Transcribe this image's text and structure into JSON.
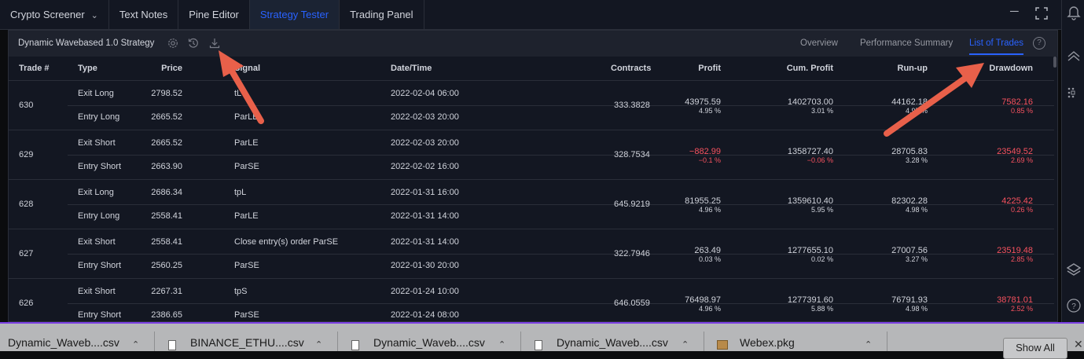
{
  "top_tabs": [
    {
      "label": "Crypto Screener",
      "has_dropdown": true,
      "active": false
    },
    {
      "label": "Text Notes",
      "active": false
    },
    {
      "label": "Pine Editor",
      "active": false
    },
    {
      "label": "Strategy Tester",
      "active": true
    },
    {
      "label": "Trading Panel",
      "active": false
    }
  ],
  "strategy": {
    "title": "Dynamic Wavebased 1.0 Strategy",
    "tabs": [
      {
        "label": "Overview",
        "active": false
      },
      {
        "label": "Performance Summary",
        "active": false
      },
      {
        "label": "List of Trades",
        "active": true
      }
    ]
  },
  "table": {
    "headers": {
      "trade": "Trade #",
      "type": "Type",
      "signal": "Signal",
      "datetime": "Date/Time",
      "price": "Price",
      "contracts": "Contracts",
      "profit": "Profit",
      "cum_profit": "Cum. Profit",
      "runup": "Run-up",
      "drawdown": "Drawdown"
    },
    "trades": [
      {
        "num": "630",
        "exit": {
          "type": "Exit Long",
          "signal": "tL",
          "datetime": "2022-02-04 06:00",
          "price": "2798.52"
        },
        "entry": {
          "type": "Entry Long",
          "signal": "ParLE",
          "datetime": "2022-02-03 20:00",
          "price": "2665.52"
        },
        "contracts": "333.3828",
        "profit": "43975.59",
        "profit_pct": "4.95 %",
        "cum_profit": "1402703.00",
        "cum_profit_pct": "3.01 %",
        "runup": "44162.18",
        "runup_pct": "4.97 %",
        "drawdown": "7582.16",
        "drawdown_pct": "0.85 %"
      },
      {
        "num": "629",
        "exit": {
          "type": "Exit Short",
          "signal": "ParLE",
          "datetime": "2022-02-03 20:00",
          "price": "2665.52"
        },
        "entry": {
          "type": "Entry Short",
          "signal": "ParSE",
          "datetime": "2022-02-02 16:00",
          "price": "2663.90"
        },
        "contracts": "328.7534",
        "profit": "−882.99",
        "profit_pct": "−0.1 %",
        "cum_profit": "1358727.40",
        "cum_profit_pct": "−0.06 %",
        "runup": "28705.83",
        "runup_pct": "3.28 %",
        "drawdown": "23549.52",
        "drawdown_pct": "2.69 %"
      },
      {
        "num": "628",
        "exit": {
          "type": "Exit Long",
          "signal": "tpL",
          "datetime": "2022-01-31 16:00",
          "price": "2686.34"
        },
        "entry": {
          "type": "Entry Long",
          "signal": "ParLE",
          "datetime": "2022-01-31 14:00",
          "price": "2558.41"
        },
        "contracts": "645.9219",
        "profit": "81955.25",
        "profit_pct": "4.96 %",
        "cum_profit": "1359610.40",
        "cum_profit_pct": "5.95 %",
        "runup": "82302.28",
        "runup_pct": "4.98 %",
        "drawdown": "4225.42",
        "drawdown_pct": "0.26 %"
      },
      {
        "num": "627",
        "exit": {
          "type": "Exit Short",
          "signal": "Close entry(s) order ParSE",
          "datetime": "2022-01-31 14:00",
          "price": "2558.41"
        },
        "entry": {
          "type": "Entry Short",
          "signal": "ParSE",
          "datetime": "2022-01-30 20:00",
          "price": "2560.25"
        },
        "contracts": "322.7946",
        "profit": "263.49",
        "profit_pct": "0.03 %",
        "cum_profit": "1277655.10",
        "cum_profit_pct": "0.02 %",
        "runup": "27007.56",
        "runup_pct": "3.27 %",
        "drawdown": "23519.48",
        "drawdown_pct": "2.85 %"
      },
      {
        "num": "626",
        "exit": {
          "type": "Exit Short",
          "signal": "tpS",
          "datetime": "2022-01-24 10:00",
          "price": "2267.31"
        },
        "entry": {
          "type": "Entry Short",
          "signal": "ParSE",
          "datetime": "2022-01-24 08:00",
          "price": "2386.65"
        },
        "contracts": "646.0559",
        "profit": "76498.97",
        "profit_pct": "4.96 %",
        "cum_profit": "1277391.60",
        "cum_profit_pct": "5.88 %",
        "runup": "76791.93",
        "runup_pct": "4.98 %",
        "drawdown": "38781.01",
        "drawdown_pct": "2.52 %"
      }
    ]
  },
  "downloads": {
    "items": [
      {
        "name": "Dynamic_Waveb....csv"
      },
      {
        "name": "BINANCE_ETHU....csv"
      },
      {
        "name": "Dynamic_Waveb....csv"
      },
      {
        "name": "Dynamic_Waveb....csv"
      },
      {
        "name": "Webex.pkg"
      }
    ],
    "show_all": "Show All"
  },
  "colors": {
    "accent": "#2962ff",
    "negative": "#f7525f",
    "annotation_arrow": "#e8604a",
    "download_bar_border": "#7b3fe4"
  },
  "icons": {
    "settings": "gear-icon",
    "history": "history-icon",
    "export": "download-icon",
    "help": "help-icon",
    "minimize": "minimize-icon",
    "maximize": "fullscreen-icon"
  }
}
